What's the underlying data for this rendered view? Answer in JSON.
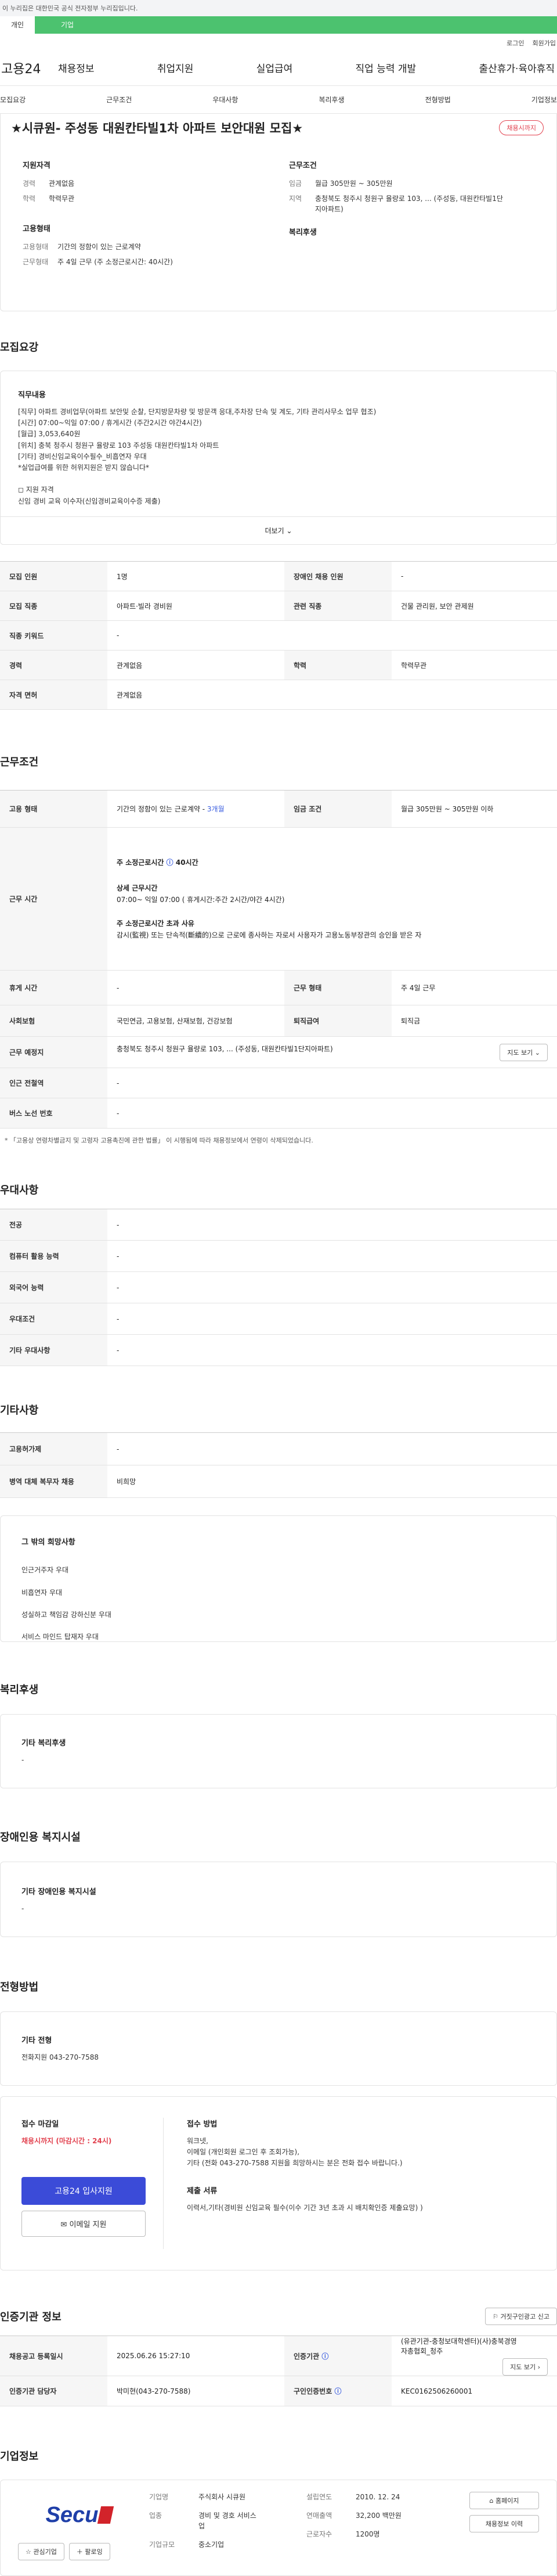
{
  "gov_banner": "이 누리집은 대한민국 공식 전자정부 누리집입니다.",
  "user_tabs": [
    "개인",
    "기업"
  ],
  "util": [
    "로그인",
    "회원가입"
  ],
  "logo": "고용24",
  "gnb": [
    "채용정보",
    "취업지원",
    "실업급여",
    "직업 능력 개발",
    "출산휴가·육아휴직"
  ],
  "tabs": [
    "모집요강",
    "근무조건",
    "우대사항",
    "복리후생",
    "전형방법",
    "기업정보"
  ],
  "job": {
    "title": "★시큐원- 주성동 대원칸타빌1차 아파트 보안대원 모집★",
    "status": "채용시까지"
  },
  "summary": {
    "qual_title": "지원자격",
    "qual": [
      {
        "k": "경력",
        "v": "관계없음"
      },
      {
        "k": "학력",
        "v": "학력무관"
      }
    ],
    "work_title": "근무조건",
    "work": [
      {
        "k": "임금",
        "v": "월급 305만원 ~ 305만원"
      },
      {
        "k": "지역",
        "v": "충청북도 청주시 청원구 율량로 103, ... (주성동, 대원칸타빌1단지아파트)"
      }
    ],
    "emp_title": "고용형태",
    "emp": [
      {
        "k": "고용형태",
        "v": "기간의 정함이 있는 근로계약"
      },
      {
        "k": "근무형태",
        "v": "주 4일 근무 (주 소정근로시간: 40시간)"
      }
    ],
    "welfare_title": "복리후생"
  },
  "recruit": {
    "title": "모집요강",
    "duty_title": "직무내용",
    "duty_text": "[직무] 아파트 경비업무(아파트 보안및 순찰, 단지방문차량 및 방문객 응대,주차장 단속 및 계도, 기타 관리사무소 업무 협조)\n[시간] 07:00~익일 07:00 /  휴게시간 (주간2시간 야간4시간)\n[월급] 3,053,640원\n[위치] 충북 청주시 청원구 율량로 103 주성동 대원칸타빌1차 아파트\n[기타] 경비신임교육이수필수_비흡연자 우대\n*실업급여를 위한  허위지원은 받지 않습니다*\n\n◻ 지원 자격\n신임 경비 교육 이수자(신임경비교육이수증 제출)",
    "more": "더보기",
    "rows": [
      [
        {
          "k": "모집 인원",
          "v": "1명"
        },
        {
          "k": "장애인 채용 인원",
          "v": "-"
        }
      ],
      [
        {
          "k": "모집 직종",
          "v": "아파트·빌라 경비원"
        },
        {
          "k": "관련 직종",
          "v": "건물 관리원, 보안 관제원"
        }
      ],
      [
        {
          "k": "직종 키워드",
          "v": "-"
        }
      ],
      [
        {
          "k": "경력",
          "v": "관계없음"
        },
        {
          "k": "학력",
          "v": "학력무관"
        }
      ],
      [
        {
          "k": "자격 면허",
          "v": "관계없음"
        }
      ]
    ]
  },
  "conditions": {
    "title": "근무조건",
    "emp_k": "고용 형태",
    "emp_v": "기간의 정함이 있는 근로계약 - ",
    "emp_period": "3개월",
    "wage_k": "임금 조건",
    "wage_v": "월급 305만원 ~ 305만원 이하",
    "hours_k": "근무 시간",
    "hours_week": "주 소정근로시간 ",
    "hours_week_v": "40시간",
    "hours_detail_t": "상세 근무시간",
    "hours_detail": "07:00~ 익일 07:00 ( 휴게시간:주간 2시간/야간 4시간)",
    "overtime_t": "주 소정근로시간 초과 사유",
    "overtime": "감시(監視) 또는 단속적(斷續的)으로 근로에 종사하는 자로서 사용자가 고용노동부장관의 승인을 받은 자",
    "rows": [
      [
        {
          "k": "휴게 시간",
          "v": "-"
        },
        {
          "k": "근무 형태",
          "v": "주 4일 근무"
        }
      ],
      [
        {
          "k": "사회보험",
          "v": "국민연금, 고용보험, 산재보험, 건강보험"
        },
        {
          "k": "퇴직급여",
          "v": "퇴직금"
        }
      ]
    ],
    "place_k": "근무 예정지",
    "place_v": "충청북도 청주시 청원구 율량로 103, ... (주성동, 대원칸타빌1단지아파트)",
    "map_btn": "지도 보기",
    "station_k": "인근 전철역",
    "station_v": "-",
    "bus_k": "버스 노선 번호",
    "bus_v": "-",
    "note": "* 「고용상 연령차별금지 및 고령자 고용촉진에 관한 법률」 이 시행됨에 따라 채용정보에서 연령이 삭제되었습니다."
  },
  "preference": {
    "title": "우대사항",
    "rows": [
      {
        "k": "전공",
        "v": "-"
      },
      {
        "k": "컴퓨터 활용 능력",
        "v": "-"
      },
      {
        "k": "외국어 능력",
        "v": "-"
      },
      {
        "k": "우대조건",
        "v": "-"
      },
      {
        "k": "기타 우대사항",
        "v": "-"
      }
    ]
  },
  "etc": {
    "title": "기타사항",
    "rows": [
      {
        "k": "고용허가제",
        "v": "-"
      },
      {
        "k": "병역 대체 복무자 채용",
        "v": "비희망"
      }
    ],
    "wish_title": "그 밖의 희망사항",
    "wish": [
      "인근거주자 우대",
      "비흡연자 우대",
      "성실하고 책임감 강하신분 우대",
      "서비스 마인드 탑재자 우대"
    ]
  },
  "welfare": {
    "title": "복리후생",
    "sub": "기타 복리후생",
    "value": "-"
  },
  "disabled": {
    "title": "장애인용 복지시설",
    "sub": "기타 장애인용 복지시설",
    "value": "-"
  },
  "process": {
    "title": "전형방법",
    "other_t": "기타 전형",
    "other_v": "전화지원 043-270-7588",
    "deadline_t": "접수 마감일",
    "deadline_v": "채용시까지 (마감시간 : 24시)",
    "apply_btn": "고용24 입사지원",
    "email_btn": "이메일 지원",
    "method_t": "접수 방법",
    "method_v": "워크넷,\n이메일 (개인회원 로그인 후 조회가능),\n기타 (전화 043-270-7588  지원을 희망하시는 분은 전화 접수 바랍니다.)",
    "docs_t": "제출 서류",
    "docs_v": "이력서,기타(경비원 신임교육 필수(이수 기간 3년 초과 시 배치확인증 제출요망) )"
  },
  "agency": {
    "title": "인증기관 정보",
    "report_btn": "거짓구인광고 신고",
    "rows": [
      [
        {
          "k": "채용공고 등록일시",
          "v": "2025.06.26 15:27:10"
        },
        {
          "k": "인증기관",
          "v": "(유관기관-충청보대학센터)(사)충북경영자총협회_청주"
        }
      ],
      [
        {
          "k": "인증기관 담당자",
          "v": "박미현(043-270-7588)"
        },
        {
          "k": "구인인증번호",
          "v": "KEC0162506260001"
        }
      ]
    ],
    "map_btn": "지도 보기"
  },
  "company": {
    "title": "기업정보",
    "logo_text": "Secu",
    "fav_btn": "관심기업",
    "follow_btn": "팔로잉",
    "rows": [
      [
        {
          "k": "기업명",
          "v": "주식회사 시큐원"
        },
        {
          "k": "설립연도",
          "v": "2010. 12. 24"
        }
      ],
      [
        {
          "k": "업종",
          "v": "경비 및 경호 서비스업"
        },
        {
          "k": "연매출액",
          "v": "32,200 백만원"
        }
      ],
      [
        {
          "k": "기업규모",
          "v": "중소기업"
        },
        {
          "k": "근로자수",
          "v": "1200명"
        }
      ]
    ],
    "home_btn": "홈페이지",
    "jobs_btn": "채용정보 이력"
  }
}
